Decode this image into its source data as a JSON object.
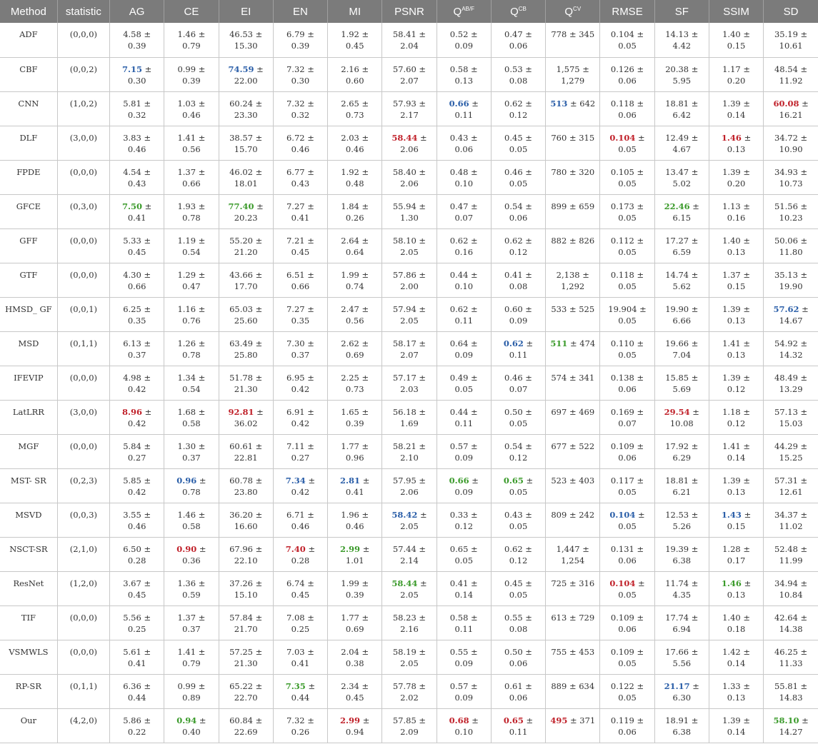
{
  "colors": {
    "header_bg": "#7b7b7b",
    "red": "#c0212a",
    "blue": "#2a5ea8",
    "green": "#3a9a2a"
  },
  "headers": [
    {
      "text": "Method"
    },
    {
      "text": "statistic"
    },
    {
      "text": "AG"
    },
    {
      "text": "CE"
    },
    {
      "text": "EI"
    },
    {
      "text": "EN"
    },
    {
      "text": "MI"
    },
    {
      "text": "PSNR"
    },
    {
      "text": "Q",
      "sup": "AB/F"
    },
    {
      "text": "Q",
      "sup": "CB"
    },
    {
      "text": "Q",
      "sup": "CV"
    },
    {
      "text": "RMSE"
    },
    {
      "text": "SF"
    },
    {
      "text": "SSIM"
    },
    {
      "text": "SD"
    }
  ],
  "rows": [
    [
      "ADF",
      "(0,0,0)",
      "4.58 ± 0.39",
      "1.46 ± 0.79",
      "46.53 ± 15.30",
      "6.79 ± 0.39",
      "1.92 ± 0.45",
      "58.41 ± 2.04",
      "0.52 ± 0.09",
      "0.47 ± 0.06",
      "778 ± 345",
      "0.104 ± 0.05",
      "14.13 ± 4.42",
      "1.40 ± 0.15",
      "35.19 ± 10.61"
    ],
    [
      "CBF",
      "(0,0,2)",
      "7.15 ± 0.30",
      "0.99 ± 0.39",
      "74.59 ± 22.00",
      "7.32 ± 0.30",
      "2.16 ± 0.60",
      "57.60 ± 2.07",
      "0.58 ± 0.13",
      "0.53 ± 0.08",
      "1,575 ± 1,279",
      "0.126 ± 0.06",
      "20.38 ± 5.95",
      "1.17 ± 0.20",
      "48.54 ± 11.92"
    ],
    [
      "CNN",
      "(1,0,2)",
      "5.81 ± 0.32",
      "1.03 ± 0.46",
      "60.24 ± 23.30",
      "7.32 ± 0.32",
      "2.65 ± 0.73",
      "57.93 ± 2.17",
      "0.66 ± 0.11",
      "0.62 ± 0.12",
      "513 ± 642",
      "0.118 ± 0.06",
      "18.81 ± 6.42",
      "1.39 ± 0.14",
      "60.08 ± 16.21"
    ],
    [
      "DLF",
      "(3,0,0)",
      "3.83 ± 0.46",
      "1.41 ± 0.56",
      "38.57 ± 15.70",
      "6.72 ± 0.46",
      "2.03 ± 0.46",
      "58.44 ± 2.06",
      "0.43 ± 0.06",
      "0.45 ± 0.05",
      "760 ± 315",
      "0.104 ± 0.05",
      "12.49 ± 4.67",
      "1.46 ± 0.13",
      "34.72 ± 10.90"
    ],
    [
      "FPDE",
      "(0,0,0)",
      "4.54 ± 0.43",
      "1.37 ± 0.66",
      "46.02 ± 18.01",
      "6.77 ± 0.43",
      "1.92 ± 0.48",
      "58.40 ± 2.06",
      "0.48 ± 0.10",
      "0.46 ± 0.05",
      "780 ± 320",
      "0.105 ± 0.05",
      "13.47 ± 5.02",
      "1.39 ± 0.20",
      "34.93 ± 10.73"
    ],
    [
      "GFCE",
      "(0,3,0)",
      "7.50 ± 0.41",
      "1.93 ± 0.78",
      "77.40 ± 20.23",
      "7.27 ± 0.41",
      "1.84 ± 0.26",
      "55.94 ± 1.30",
      "0.47 ± 0.07",
      "0.54 ± 0.06",
      "899 ± 659",
      "0.173 ± 0.05",
      "22.46 ± 6.15",
      "1.13 ± 0.16",
      "51.56 ± 10.23"
    ],
    [
      "GFF",
      "(0,0,0)",
      "5.33 ± 0.45",
      "1.19 ± 0.54",
      "55.20 ± 21.20",
      "7.21 ± 0.45",
      "2.64 ± 0.64",
      "58.10 ± 2.05",
      "0.62 ± 0.16",
      "0.62 ± 0.12",
      "882 ± 826",
      "0.112 ± 0.05",
      "17.27 ± 6.59",
      "1.40 ± 0.13",
      "50.06 ± 11.80"
    ],
    [
      "GTF",
      "(0,0,0)",
      "4.30 ± 0.66",
      "1.29 ± 0.47",
      "43.66 ± 17.70",
      "6.51 ± 0.66",
      "1.99 ± 0.74",
      "57.86 ± 2.00",
      "0.44 ± 0.10",
      "0.41 ± 0.08",
      "2,138 ± 1,292",
      "0.118 ± 0.05",
      "14.74 ± 5.62",
      "1.37 ± 0.15",
      "35.13 ± 19.90"
    ],
    [
      "HMSD_ GF",
      "(0,0,1)",
      "6.25 ± 0.35",
      "1.16 ± 0.76",
      "65.03 ± 25.60",
      "7.27 ± 0.35",
      "2.47 ± 0.56",
      "57.94 ± 2.05",
      "0.62 ± 0.11",
      "0.60 ± 0.09",
      "533 ± 525",
      "19.904 ± 0.05",
      "19.90 ± 6.66",
      "1.39 ± 0.13",
      "57.62 ± 14.67"
    ],
    [
      "MSD",
      "(0,1,1)",
      "6.13 ± 0.37",
      "1.26 ± 0.78",
      "63.49 ± 25.80",
      "7.30 ± 0.37",
      "2.62 ± 0.69",
      "58.17 ± 2.07",
      "0.64 ± 0.09",
      "0.62 ± 0.11",
      "511 ± 474",
      "0.110 ± 0.05",
      "19.66 ± 7.04",
      "1.41 ± 0.13",
      "54.92 ± 14.32"
    ],
    [
      "IFEVIP",
      "(0,0,0)",
      "4.98 ± 0.42",
      "1.34 ± 0.54",
      "51.78 ± 21.30",
      "6.95 ± 0.42",
      "2.25 ± 0.73",
      "57.17 ± 2.03",
      "0.49 ± 0.05",
      "0.46 ± 0.07",
      "574 ± 341",
      "0.138 ± 0.06",
      "15.85 ± 5.69",
      "1.39 ± 0.12",
      "48.49 ± 13.29"
    ],
    [
      "LatLRR",
      "(3,0,0)",
      "8.96 ± 0.42",
      "1.68 ± 0.58",
      "92.81 ± 36.02",
      "6.91 ± 0.42",
      "1.65 ± 0.39",
      "56.18 ± 1.69",
      "0.44 ± 0.11",
      "0.50 ± 0.05",
      "697 ± 469",
      "0.169 ± 0.07",
      "29.54 ± 10.08",
      "1.18 ± 0.12",
      "57.13 ± 15.03"
    ],
    [
      "MGF",
      "(0,0,0)",
      "5.84 ± 0.27",
      "1.30 ± 0.37",
      "60.61 ± 22.81",
      "7.11 ± 0.27",
      "1.77 ± 0.96",
      "58.21 ± 2.10",
      "0.57 ± 0.09",
      "0.54 ± 0.12",
      "677 ± 522",
      "0.109 ± 0.06",
      "17.92 ± 6.29",
      "1.41 ± 0.14",
      "44.29 ± 15.25"
    ],
    [
      "MST- SR",
      "(0,2,3)",
      "5.85 ± 0.42",
      "0.96 ± 0.78",
      "60.78 ± 23.80",
      "7.34 ± 0.42",
      "2.81 ± 0.41",
      "57.95 ± 2.06",
      "0.66 ± 0.09",
      "0.65 ± 0.05",
      "523 ± 403",
      "0.117 ± 0.05",
      "18.81 ± 6.21",
      "1.39 ± 0.13",
      "57.31 ± 12.61"
    ],
    [
      "MSVD",
      "(0,0,3)",
      "3.55 ± 0.46",
      "1.46 ± 0.58",
      "36.20 ± 16.60",
      "6.71 ± 0.46",
      "1.96 ± 0.46",
      "58.42 ± 2.05",
      "0.33 ± 0.12",
      "0.43 ± 0.05",
      "809 ± 242",
      "0.104 ± 0.05",
      "12.53 ± 5.26",
      "1.43 ± 0.15",
      "34.37 ± 11.02"
    ],
    [
      "NSCT-SR",
      "(2,1,0)",
      "6.50 ± 0.28",
      "0.90 ± 0.36",
      "67.96 ± 22.10",
      "7.40 ± 0.28",
      "2.99 ± 1.01",
      "57.44 ± 2.14",
      "0.65 ± 0.05",
      "0.62 ± 0.12",
      "1,447 ± 1,254",
      "0.131 ± 0.06",
      "19.39 ± 6.38",
      "1.28 ± 0.17",
      "52.48 ± 11.99"
    ],
    [
      "ResNet",
      "(1,2,0)",
      "3.67 ± 0.45",
      "1.36 ± 0.59",
      "37.26 ± 15.10",
      "6.74 ± 0.45",
      "1.99 ± 0.39",
      "58.44 ± 2.05",
      "0.41 ± 0.14",
      "0.45 ± 0.05",
      "725 ± 316",
      "0.104 ± 0.05",
      "11.74 ± 4.35",
      "1.46 ± 0.13",
      "34.94 ± 10.84"
    ],
    [
      "TIF",
      "(0,0,0)",
      "5.56 ± 0.25",
      "1.37 ± 0.37",
      "57.84 ± 21.70",
      "7.08 ± 0.25",
      "1.77 ± 0.69",
      "58.23 ± 2.16",
      "0.58 ± 0.11",
      "0.55 ± 0.08",
      "613 ± 729",
      "0.109 ± 0.06",
      "17.74 ± 6.94",
      "1.40 ± 0.18",
      "42.64 ± 14.38"
    ],
    [
      "VSMWLS",
      "(0,0,0)",
      "5.61 ± 0.41",
      "1.41 ± 0.79",
      "57.25 ± 21.30",
      "7.03 ± 0.41",
      "2.04 ± 0.38",
      "58.19 ± 2.05",
      "0.55 ± 0.09",
      "0.50 ± 0.06",
      "755 ± 453",
      "0.109 ± 0.05",
      "17.66 ± 5.56",
      "1.42 ± 0.14",
      "46.25 ± 11.33"
    ],
    [
      "RP-SR",
      "(0,1,1)",
      "6.36 ± 0.44",
      "0.99 ± 0.89",
      "65.22 ± 22.70",
      "7.35 ± 0.44",
      "2.34 ± 0.45",
      "57.78 ± 2.02",
      "0.57 ± 0.09",
      "0.61 ± 0.06",
      "889 ± 634",
      "0.122 ± 0.05",
      "21.17 ± 6.30",
      "1.33 ± 0.13",
      "55.81 ± 14.83"
    ],
    [
      "Our",
      "(4,2,0)",
      "5.86 ± 0.22",
      "0.94 ± 0.40",
      "60.84 ± 22.69",
      "7.32 ± 0.26",
      "2.99 ± 0.94",
      "57.85 ± 2.09",
      "0.68 ± 0.10",
      "0.65 ± 0.11",
      "495 ± 371",
      "0.119 ± 0.06",
      "18.91 ± 6.38",
      "1.39 ± 0.14",
      "58.10 ± 14.27"
    ]
  ],
  "highlights": [
    {
      "row": 1,
      "col": 2,
      "color": "blue"
    },
    {
      "row": 1,
      "col": 4,
      "color": "blue"
    },
    {
      "row": 2,
      "col": 8,
      "color": "blue"
    },
    {
      "row": 2,
      "col": 10,
      "color": "blue"
    },
    {
      "row": 2,
      "col": 14,
      "color": "red"
    },
    {
      "row": 3,
      "col": 7,
      "color": "red"
    },
    {
      "row": 3,
      "col": 11,
      "color": "red"
    },
    {
      "row": 3,
      "col": 13,
      "color": "red"
    },
    {
      "row": 5,
      "col": 2,
      "color": "green"
    },
    {
      "row": 5,
      "col": 4,
      "color": "green"
    },
    {
      "row": 5,
      "col": 12,
      "color": "green"
    },
    {
      "row": 8,
      "col": 14,
      "color": "blue"
    },
    {
      "row": 9,
      "col": 9,
      "color": "blue"
    },
    {
      "row": 9,
      "col": 10,
      "color": "green"
    },
    {
      "row": 11,
      "col": 2,
      "color": "red"
    },
    {
      "row": 11,
      "col": 4,
      "color": "red"
    },
    {
      "row": 11,
      "col": 12,
      "color": "red"
    },
    {
      "row": 13,
      "col": 3,
      "color": "blue"
    },
    {
      "row": 13,
      "col": 5,
      "color": "blue"
    },
    {
      "row": 13,
      "col": 6,
      "color": "blue"
    },
    {
      "row": 13,
      "col": 8,
      "color": "green"
    },
    {
      "row": 13,
      "col": 9,
      "color": "green"
    },
    {
      "row": 14,
      "col": 7,
      "color": "blue"
    },
    {
      "row": 14,
      "col": 11,
      "color": "blue"
    },
    {
      "row": 14,
      "col": 13,
      "color": "blue"
    },
    {
      "row": 15,
      "col": 3,
      "color": "red"
    },
    {
      "row": 15,
      "col": 5,
      "color": "red"
    },
    {
      "row": 15,
      "col": 6,
      "color": "green"
    },
    {
      "row": 16,
      "col": 7,
      "color": "green"
    },
    {
      "row": 16,
      "col": 11,
      "color": "red"
    },
    {
      "row": 16,
      "col": 13,
      "color": "green"
    },
    {
      "row": 19,
      "col": 5,
      "color": "green"
    },
    {
      "row": 19,
      "col": 12,
      "color": "blue"
    },
    {
      "row": 20,
      "col": 3,
      "color": "green"
    },
    {
      "row": 20,
      "col": 6,
      "color": "red"
    },
    {
      "row": 20,
      "col": 8,
      "color": "red"
    },
    {
      "row": 20,
      "col": 9,
      "color": "red"
    },
    {
      "row": 20,
      "col": 10,
      "color": "red"
    },
    {
      "row": 20,
      "col": 14,
      "color": "green"
    }
  ]
}
